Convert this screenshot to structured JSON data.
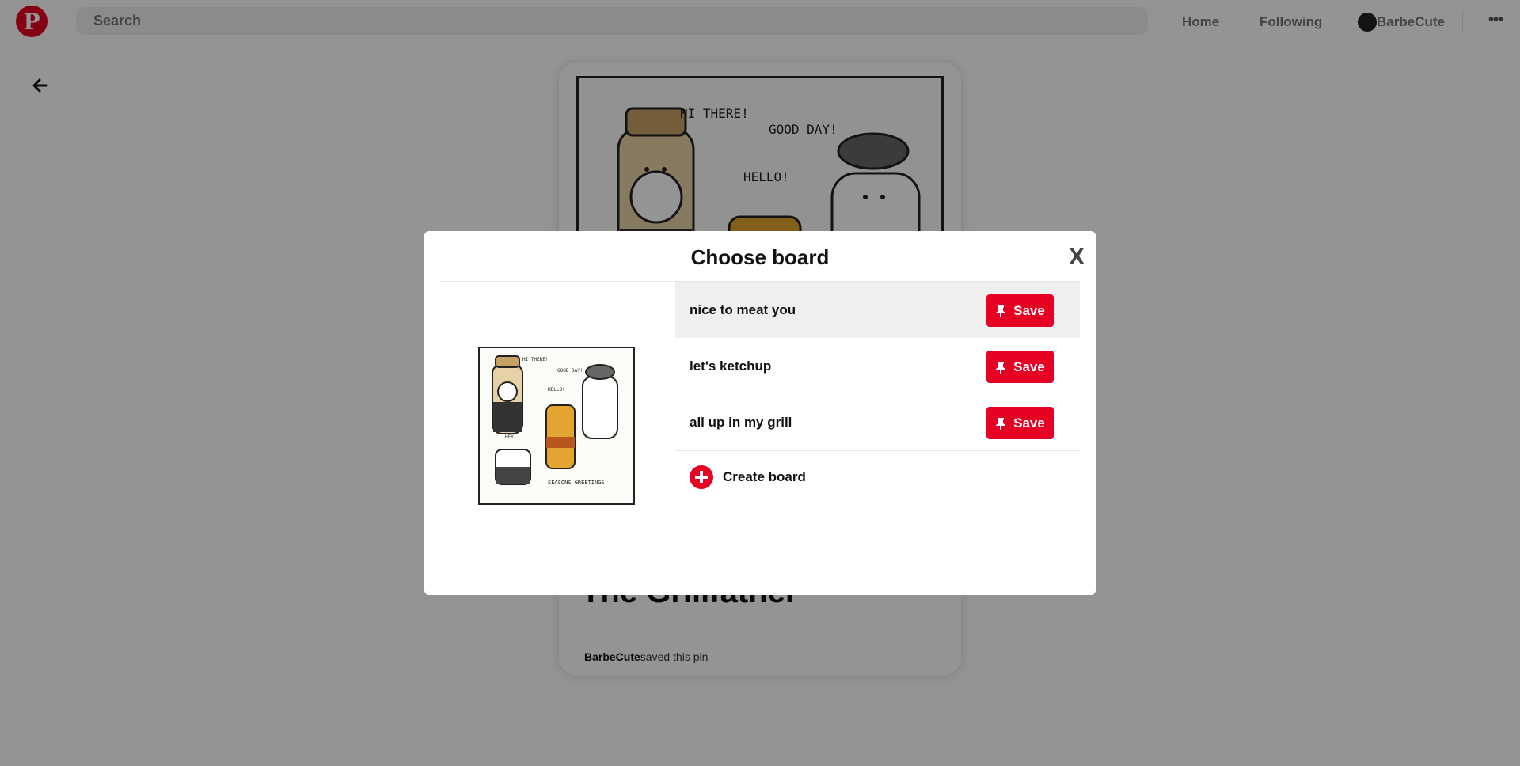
{
  "nav": {
    "logo": "P",
    "search_placeholder": "Search",
    "home": "Home",
    "following": "Following",
    "username": "BarbeCute",
    "more": "•••"
  },
  "pin": {
    "title": "The Grillfather",
    "saver": "BarbeCute",
    "saved_text": "saved this pin",
    "image_speech": [
      "HI THERE!",
      "GOOD DAY!",
      "HELLO!",
      "HEY!",
      "SEASONS GREETINGS"
    ]
  },
  "modal": {
    "title": "Choose board",
    "close": "X",
    "boards": [
      {
        "name": "nice to meat you",
        "save_label": "Save"
      },
      {
        "name": "let's ketchup",
        "save_label": "Save"
      },
      {
        "name": "all up in my grill",
        "save_label": "Save"
      }
    ],
    "create_label": "Create board"
  },
  "colors": {
    "brand_red": "#e60023",
    "overlay": "rgba(0,0,0,0.42)"
  },
  "icons": {
    "back": "arrow-left-icon",
    "pin": "pushpin-icon",
    "create": "plus-circle-icon",
    "more": "ellipsis-icon"
  }
}
